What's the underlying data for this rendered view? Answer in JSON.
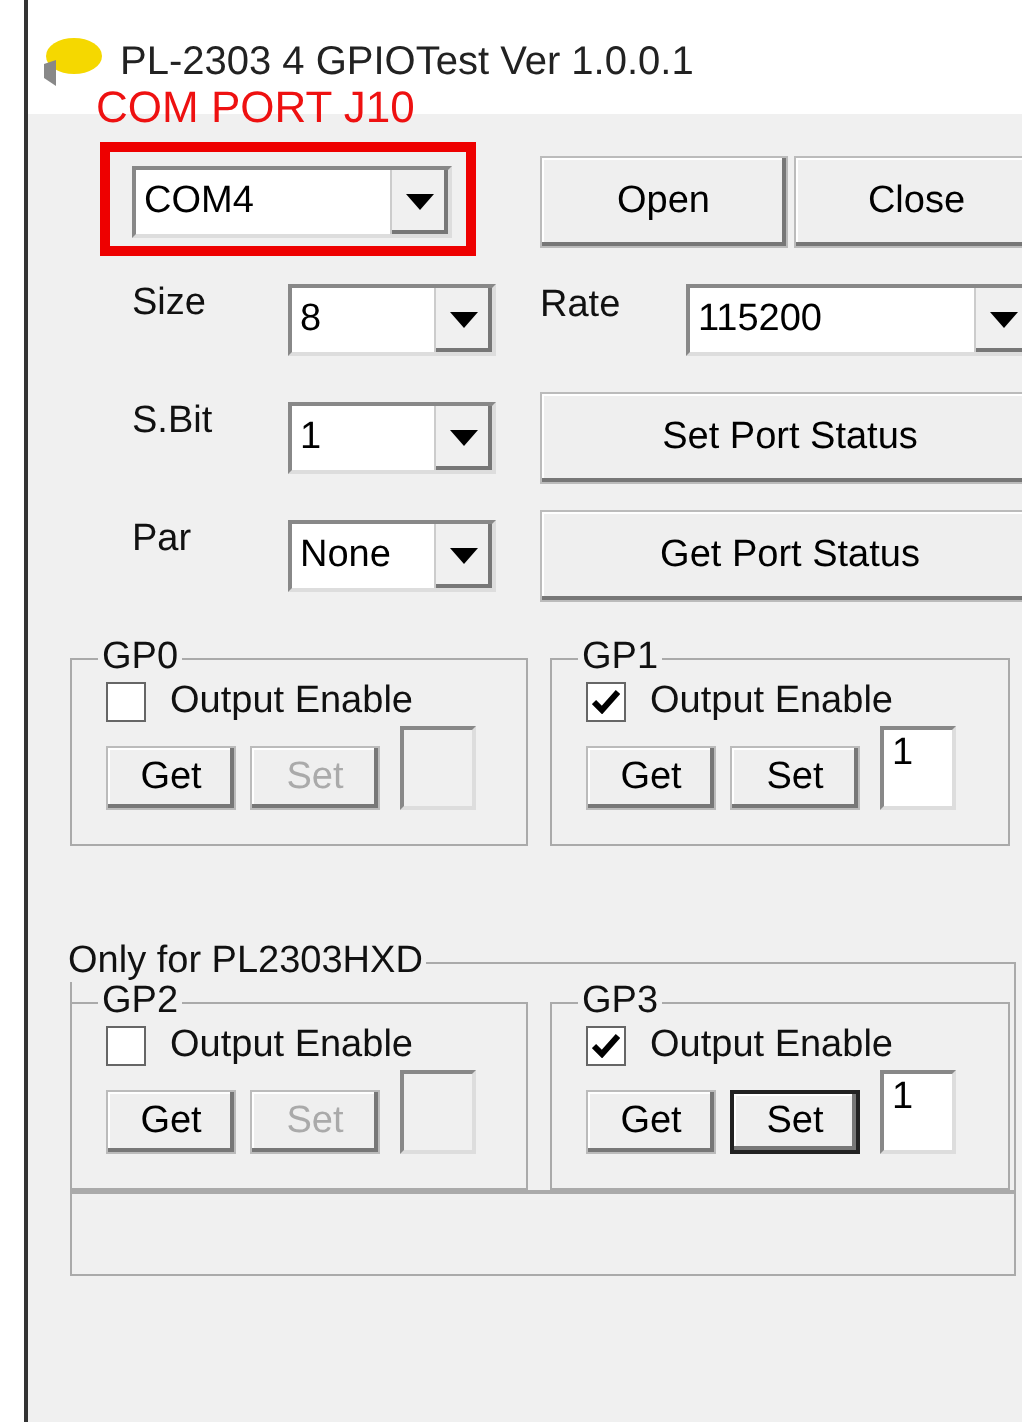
{
  "window": {
    "title": "PL-2303 4 GPIOTest Ver 1.0.0.1"
  },
  "annotation": {
    "label": "COM PORT J10"
  },
  "port": {
    "value": "COM4"
  },
  "port_buttons": [
    {
      "label": "Open"
    },
    {
      "label": "Close"
    }
  ],
  "fields": [
    {
      "label": "Size",
      "value": "8"
    },
    {
      "label": "S.Bit",
      "value": "1"
    },
    {
      "label": "Par",
      "value": "None"
    }
  ],
  "rate": {
    "label": "Rate",
    "value": "115200"
  },
  "port_status_buttons": [
    {
      "label": "Set Port Status"
    },
    {
      "label": "Get Port Status"
    }
  ],
  "gpio_groups": [
    {
      "title": "GP0",
      "output_enable": {
        "label": "Output Enable",
        "checked": false
      },
      "buttons": [
        {
          "label": "Get",
          "disabled": false,
          "focused": false
        },
        {
          "label": "Set",
          "disabled": true,
          "focused": false
        }
      ],
      "value_disabled": true
    },
    {
      "title": "GP1",
      "output_enable": {
        "label": "Output Enable",
        "checked": true
      },
      "buttons": [
        {
          "label": "Get",
          "disabled": false,
          "focused": false
        },
        {
          "label": "Set",
          "disabled": false,
          "focused": false
        }
      ],
      "value": "1",
      "value_disabled": false
    }
  ],
  "hxd_group": {
    "title": "Only for PL2303HXD",
    "gpio_groups": [
      {
        "title": "GP2",
        "output_enable": {
          "label": "Output Enable",
          "checked": false
        },
        "buttons": [
          {
            "label": "Get",
            "disabled": false,
            "focused": false
          },
          {
            "label": "Set",
            "disabled": true,
            "focused": false
          }
        ],
        "value_disabled": true
      },
      {
        "title": "GP3",
        "output_enable": {
          "label": "Output Enable",
          "checked": true
        },
        "buttons": [
          {
            "label": "Get",
            "disabled": false,
            "focused": false
          },
          {
            "label": "Set",
            "disabled": false,
            "focused": true
          }
        ],
        "value": "1",
        "value_disabled": false
      }
    ]
  }
}
